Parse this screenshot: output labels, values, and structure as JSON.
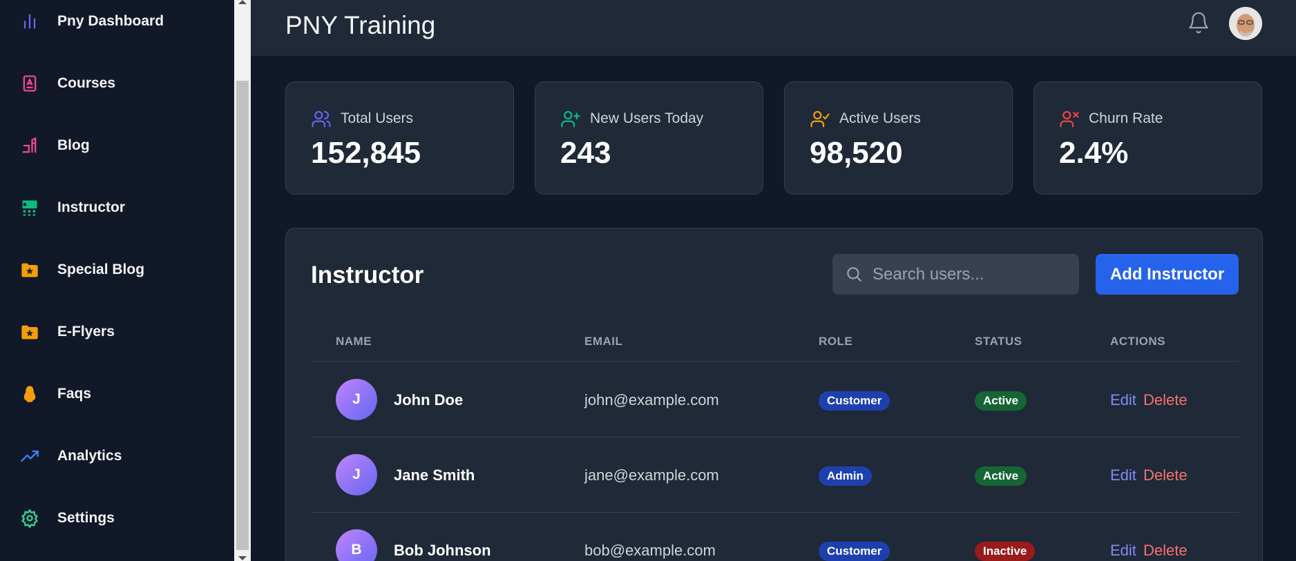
{
  "sidebar": {
    "items": [
      {
        "label": "Pny Dashboard",
        "icon": "bar-chart-icon",
        "color": "#6366f1"
      },
      {
        "label": "Courses",
        "icon": "book-icon",
        "color": "#ec4899"
      },
      {
        "label": "Blog",
        "icon": "pen-icon",
        "color": "#ec4899"
      },
      {
        "label": "Instructor",
        "icon": "teacher-icon",
        "color": "#10b981"
      },
      {
        "label": "Special Blog",
        "icon": "folder-star-icon",
        "color": "#f59e0b"
      },
      {
        "label": "E-Flyers",
        "icon": "folder-star-icon",
        "color": "#f59e0b"
      },
      {
        "label": "Faqs",
        "icon": "penguin-icon",
        "color": "#f59e0b"
      },
      {
        "label": "Analytics",
        "icon": "trending-up-icon",
        "color": "#3b82f6"
      },
      {
        "label": "Settings",
        "icon": "gear-icon",
        "color": "#34d399"
      }
    ]
  },
  "header": {
    "title": "PNY Training"
  },
  "stats": [
    {
      "label": "Total Users",
      "value": "152,845",
      "icon": "users-icon",
      "color": "#6366f1"
    },
    {
      "label": "New Users Today",
      "value": "243",
      "icon": "user-plus-icon",
      "color": "#10b981"
    },
    {
      "label": "Active Users",
      "value": "98,520",
      "icon": "user-check-icon",
      "color": "#f59e0b"
    },
    {
      "label": "Churn Rate",
      "value": "2.4%",
      "icon": "user-x-icon",
      "color": "#ef4444"
    }
  ],
  "panel": {
    "title": "Instructor",
    "search_placeholder": "Search users...",
    "add_label": "Add Instructor",
    "columns": [
      "NAME",
      "EMAIL",
      "ROLE",
      "STATUS",
      "ACTIONS"
    ],
    "rows": [
      {
        "initial": "J",
        "name": "John Doe",
        "email": "john@example.com",
        "role": "Customer",
        "status": "Active",
        "edit": "Edit",
        "delete": "Delete"
      },
      {
        "initial": "J",
        "name": "Jane Smith",
        "email": "jane@example.com",
        "role": "Admin",
        "status": "Active",
        "edit": "Edit",
        "delete": "Delete"
      },
      {
        "initial": "B",
        "name": "Bob Johnson",
        "email": "bob@example.com",
        "role": "Customer",
        "status": "Inactive",
        "edit": "Edit",
        "delete": "Delete"
      }
    ]
  }
}
